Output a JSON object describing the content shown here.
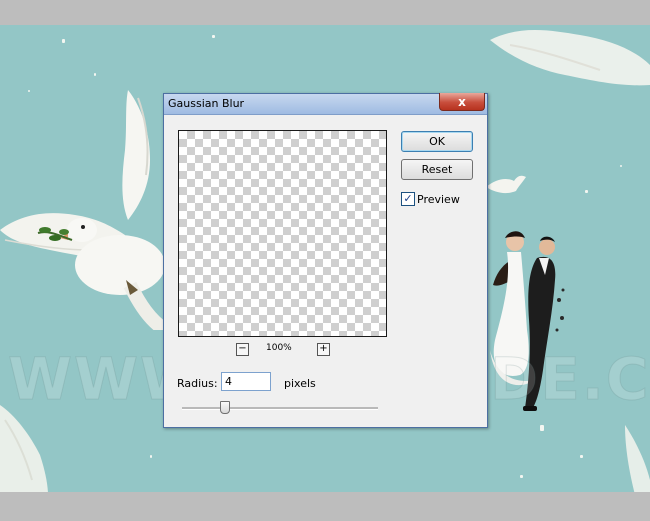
{
  "dialog": {
    "title": "Gaussian Blur",
    "close_label": "x",
    "ok_label": "OK",
    "reset_label": "Reset",
    "preview_label": "Preview",
    "preview_checked": true,
    "zoom_out_label": "−",
    "zoom_in_label": "+",
    "zoom_level": "100%",
    "radius_label": "Radius:",
    "radius_value": "4",
    "radius_units": "pixels"
  },
  "canvas": {
    "watermark_text": "WWW.PSD-DUDE.COM",
    "background_color": "#93c6c6"
  },
  "icons": {
    "close": "close-icon",
    "checkmark": "checkmark-icon",
    "zoom_out": "minus-icon",
    "zoom_in": "plus-icon"
  },
  "colors": {
    "titlebar": "#9fbbe2",
    "close_button": "#c84e3c",
    "dialog_background": "#f0f0f0"
  }
}
